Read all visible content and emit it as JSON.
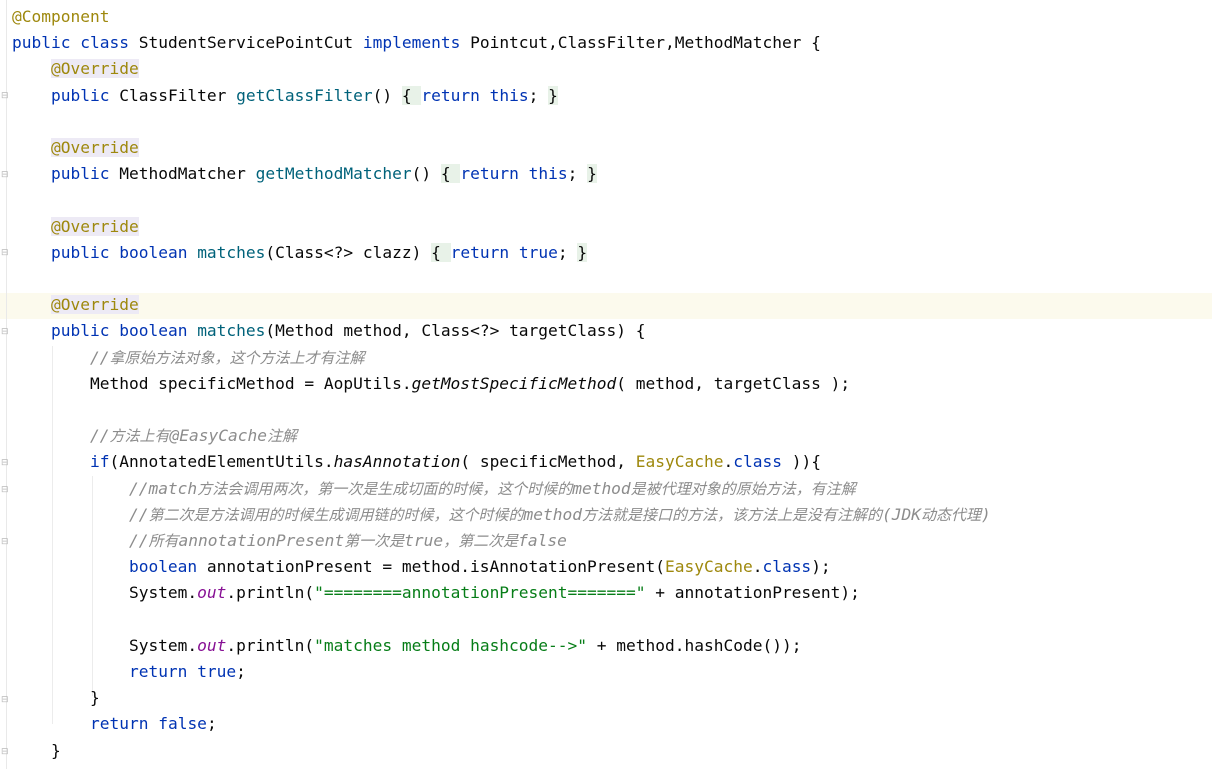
{
  "editor": {
    "lines": [
      [
        {
          "t": "@Component",
          "c": "ann"
        }
      ],
      [
        {
          "t": "public ",
          "c": "kw"
        },
        {
          "t": "class ",
          "c": "kw"
        },
        {
          "t": "StudentServicePointCut "
        },
        {
          "t": "implements ",
          "c": "kw"
        },
        {
          "t": "Pointcut,ClassFilter,MethodMatcher {"
        }
      ],
      [
        {
          "t": "    "
        },
        {
          "t": "@Override",
          "c": "ann-hl"
        }
      ],
      [
        {
          "t": "    "
        },
        {
          "t": "public ",
          "c": "kw"
        },
        {
          "t": "ClassFilter "
        },
        {
          "t": "getClassFilter",
          "c": "fn"
        },
        {
          "t": "() "
        },
        {
          "t": "{ ",
          "c": "brace-hl"
        },
        {
          "t": "return ",
          "c": "kw"
        },
        {
          "t": "this",
          "c": "kw"
        },
        {
          "t": "; "
        },
        {
          "t": "}",
          "c": "brace-hl"
        }
      ],
      [],
      [
        {
          "t": "    "
        },
        {
          "t": "@Override",
          "c": "ann-hl"
        }
      ],
      [
        {
          "t": "    "
        },
        {
          "t": "public ",
          "c": "kw"
        },
        {
          "t": "MethodMatcher "
        },
        {
          "t": "getMethodMatcher",
          "c": "fn"
        },
        {
          "t": "() "
        },
        {
          "t": "{ ",
          "c": "brace-hl"
        },
        {
          "t": "return ",
          "c": "kw"
        },
        {
          "t": "this",
          "c": "kw"
        },
        {
          "t": "; "
        },
        {
          "t": "}",
          "c": "brace-hl"
        }
      ],
      [],
      [
        {
          "t": "    "
        },
        {
          "t": "@Override",
          "c": "ann-hl"
        }
      ],
      [
        {
          "t": "    "
        },
        {
          "t": "public ",
          "c": "kw"
        },
        {
          "t": "boolean ",
          "c": "kw"
        },
        {
          "t": "matches",
          "c": "fn"
        },
        {
          "t": "(Class<?> clazz) "
        },
        {
          "t": "{ ",
          "c": "brace-hl"
        },
        {
          "t": "return ",
          "c": "kw"
        },
        {
          "t": "true",
          "c": "kw"
        },
        {
          "t": "; "
        },
        {
          "t": "}",
          "c": "brace-hl"
        }
      ],
      [],
      [
        {
          "t": "    "
        },
        {
          "t": "@Override",
          "c": "ann-hl"
        }
      ],
      [
        {
          "t": "    "
        },
        {
          "t": "public ",
          "c": "kw"
        },
        {
          "t": "boolean ",
          "c": "kw"
        },
        {
          "t": "matches",
          "c": "fn"
        },
        {
          "t": "(Method method, Class<?> targetClass) {"
        }
      ],
      [
        {
          "t": "        "
        },
        {
          "t": "//",
          "c": "cmt"
        },
        {
          "t": "拿原始方法对象，这个方法上才有注解",
          "c": "cmt-cjk"
        }
      ],
      [
        {
          "t": "        Method specificMethod = AopUtils."
        },
        {
          "t": "getMostSpecificMethod",
          "c": "static-fn"
        },
        {
          "t": "( method, targetClass );"
        }
      ],
      [],
      [
        {
          "t": "        "
        },
        {
          "t": "//",
          "c": "cmt"
        },
        {
          "t": "方法上有",
          "c": "cmt-cjk"
        },
        {
          "t": "@EasyCache",
          "c": "cmt"
        },
        {
          "t": "注解",
          "c": "cmt-cjk"
        }
      ],
      [
        {
          "t": "        "
        },
        {
          "t": "if",
          "c": "kw"
        },
        {
          "t": "(AnnotatedElementUtils."
        },
        {
          "t": "hasAnnotation",
          "c": "static-fn"
        },
        {
          "t": "( specificMethod, "
        },
        {
          "t": "EasyCache",
          "c": "cls-easy"
        },
        {
          "t": "."
        },
        {
          "t": "class",
          "c": "kw"
        },
        {
          "t": " )){"
        }
      ],
      [
        {
          "t": "            "
        },
        {
          "t": "//match",
          "c": "cmt"
        },
        {
          "t": "方法会调用两次，第一次是生成切面的时候，这个时候的",
          "c": "cmt-cjk"
        },
        {
          "t": "method",
          "c": "cmt"
        },
        {
          "t": "是被代理对象的原始方法，有注解",
          "c": "cmt-cjk"
        }
      ],
      [
        {
          "t": "            "
        },
        {
          "t": "//",
          "c": "cmt"
        },
        {
          "t": "第二次是方法调用的时候生成调用链的时候，这个时候的",
          "c": "cmt-cjk"
        },
        {
          "t": "method",
          "c": "cmt"
        },
        {
          "t": "方法就是接口的方法，该方法上是没有注解的",
          "c": "cmt-cjk"
        },
        {
          "t": "(JDK",
          "c": "cmt"
        },
        {
          "t": "动态代理",
          "c": "cmt-cjk"
        },
        {
          "t": ")",
          "c": "cmt"
        }
      ],
      [
        {
          "t": "            "
        },
        {
          "t": "//",
          "c": "cmt"
        },
        {
          "t": "所有",
          "c": "cmt-cjk"
        },
        {
          "t": "annotationPresent",
          "c": "cmt"
        },
        {
          "t": "第一次是",
          "c": "cmt-cjk"
        },
        {
          "t": "true",
          "c": "cmt"
        },
        {
          "t": "，第二次是",
          "c": "cmt-cjk"
        },
        {
          "t": "false",
          "c": "cmt"
        }
      ],
      [
        {
          "t": "            "
        },
        {
          "t": "boolean ",
          "c": "kw"
        },
        {
          "t": "annotationPresent = method.isAnnotationPresent("
        },
        {
          "t": "EasyCache",
          "c": "cls-easy"
        },
        {
          "t": "."
        },
        {
          "t": "class",
          "c": "kw"
        },
        {
          "t": ");"
        }
      ],
      [
        {
          "t": "            System."
        },
        {
          "t": "out",
          "c": "field-static"
        },
        {
          "t": ".println("
        },
        {
          "t": "\"========annotationPresent=======\"",
          "c": "str"
        },
        {
          "t": " + annotationPresent);"
        }
      ],
      [],
      [
        {
          "t": "            System."
        },
        {
          "t": "out",
          "c": "field-static"
        },
        {
          "t": ".println("
        },
        {
          "t": "\"matches method hashcode-->\"",
          "c": "str"
        },
        {
          "t": " + method.hashCode());"
        }
      ],
      [
        {
          "t": "            "
        },
        {
          "t": "return ",
          "c": "kw"
        },
        {
          "t": "true",
          "c": "kw"
        },
        {
          "t": ";"
        }
      ],
      [
        {
          "t": "        }"
        }
      ],
      [
        {
          "t": "        "
        },
        {
          "t": "return ",
          "c": "kw"
        },
        {
          "t": "false",
          "c": "kw"
        },
        {
          "t": ";"
        }
      ],
      [
        {
          "t": "    }"
        }
      ]
    ]
  },
  "colors": {
    "keyword": "#0033b3",
    "annotation": "#9e880d",
    "method": "#00627a",
    "string": "#067d17",
    "comment": "#8c8c8c",
    "static_field": "#871094",
    "caret_line": "#fcfaed"
  },
  "icons": [
    "fold-marker-icon"
  ]
}
